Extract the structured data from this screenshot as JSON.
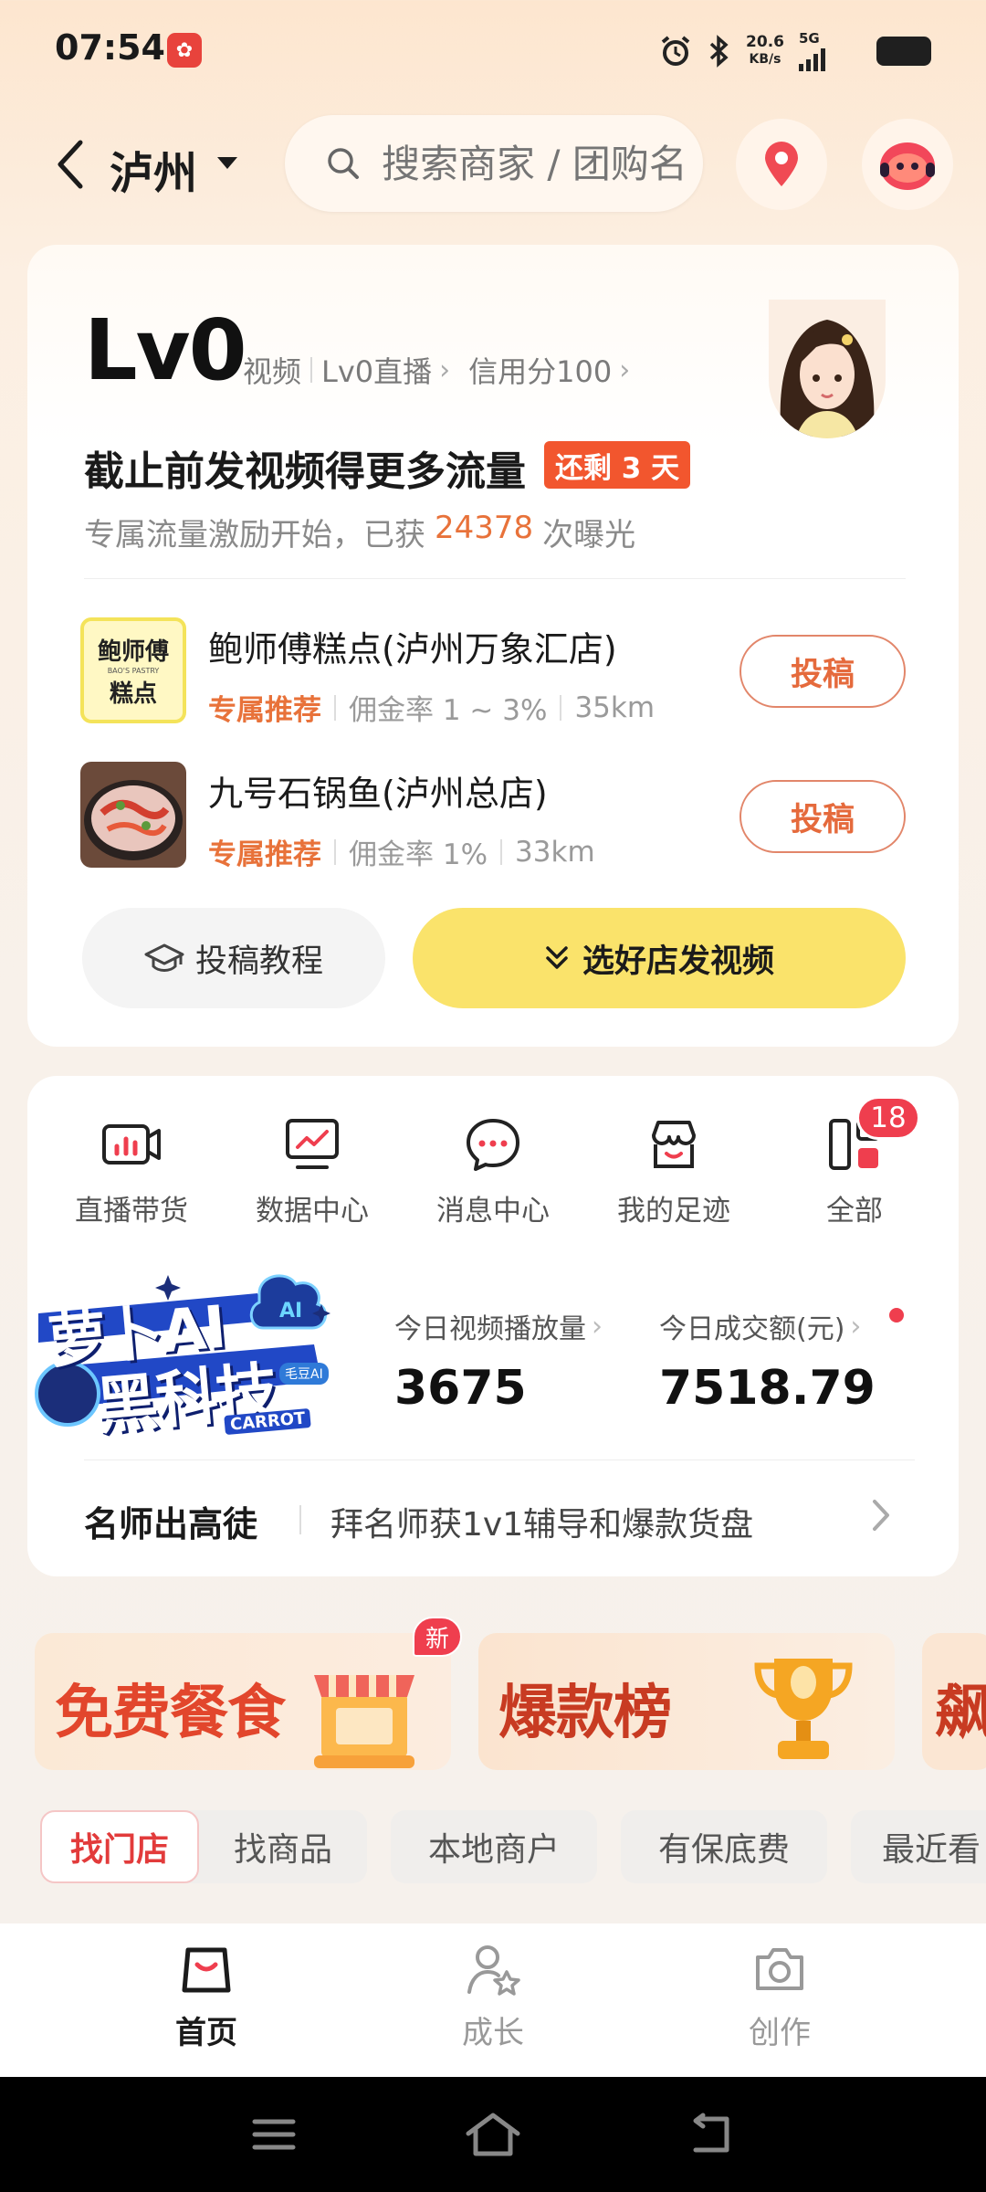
{
  "status_bar": {
    "time": "07:54",
    "net_speed_value": "20.6",
    "net_speed_unit": "KB/s",
    "network": "5G"
  },
  "header": {
    "city": "泸州",
    "search_placeholder": "搜索商家 / 团购名"
  },
  "level_card": {
    "level": "Lv0",
    "links": [
      "视频",
      "Lv0直播",
      "信用分100"
    ],
    "promo_title": "截止前发视频得更多流量",
    "days_left": "还剩 3 天",
    "sub_prefix": "专属流量激励开始，已获",
    "exposure_count": "24378",
    "sub_suffix": "次曝光",
    "shops": [
      {
        "name": "鲍师傅糕点(泸州万象汇店)",
        "thumb_text_top": "鲍师傅",
        "thumb_text_small": "BAO'S PASTRY",
        "thumb_text_bottom": "糕点",
        "tag": "专属推荐",
        "commission": "佣金率 1 ~ 3%",
        "distance": "35km",
        "button": "投稿"
      },
      {
        "name": "九号石锅鱼(泸州总店)",
        "tag": "专属推荐",
        "commission": "佣金率 1%",
        "distance": "33km",
        "button": "投稿"
      }
    ],
    "tutorial_button": "投稿教程",
    "choose_button": "选好店发视频"
  },
  "quick_actions": [
    {
      "label": "直播带货",
      "icon": "live-sales-icon"
    },
    {
      "label": "数据中心",
      "icon": "data-center-icon"
    },
    {
      "label": "消息中心",
      "icon": "message-icon"
    },
    {
      "label": "我的足迹",
      "icon": "footprint-icon"
    },
    {
      "label": "全部",
      "icon": "all-icon",
      "badge": "18"
    }
  ],
  "ai_banner": {
    "line1": "萝卜AI",
    "line2": "黑科技",
    "tag": "CARROT",
    "chip": "毛豆AI"
  },
  "stats": [
    {
      "label": "今日视频播放量",
      "value": "3675"
    },
    {
      "label": "今日成交额(元)",
      "value": "7518.79"
    }
  ],
  "mentor": {
    "title": "名师出高徒",
    "desc": "拜名师获1v1辅导和爆款货盘"
  },
  "promos": [
    {
      "label": "免费餐食",
      "badge": "新"
    },
    {
      "label": "爆款榜"
    },
    {
      "label": "飙"
    }
  ],
  "filter_tabs": [
    "找门店",
    "找商品",
    "本地商户",
    "有保底费",
    "最近看"
  ],
  "bottom_nav": [
    {
      "label": "首页",
      "icon": "home-bag-icon",
      "active": true
    },
    {
      "label": "成长",
      "icon": "growth-user-icon",
      "active": false
    },
    {
      "label": "创作",
      "icon": "camera-icon",
      "active": false
    }
  ],
  "colors": {
    "accent_orange": "#e8723a",
    "badge_red": "#ef3e4e",
    "cta_yellow": "#fae36b"
  }
}
